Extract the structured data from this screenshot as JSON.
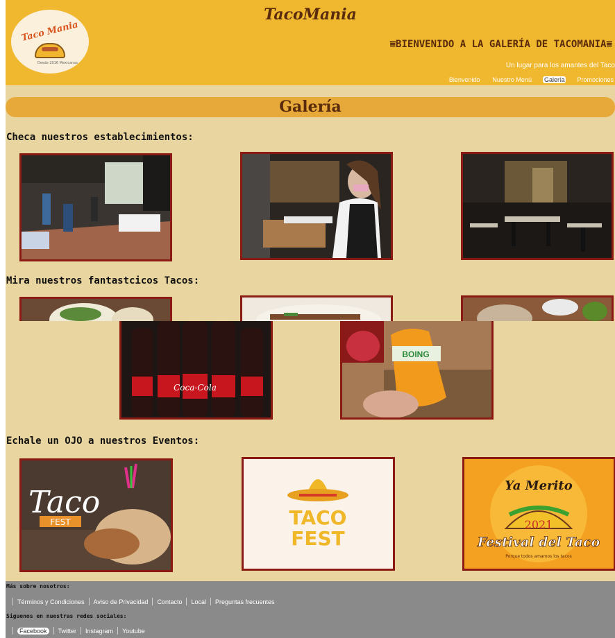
{
  "header": {
    "logo_text": "Taco Mania",
    "logo_subtext": "Desde 2016 Mexicanos",
    "site_title": "TacoMania",
    "welcome": "⩸BIENVENIDO A LA GALERÍA DE TACOMANIA⩸",
    "tagline": "Un lugar para los amantes del Taco"
  },
  "nav": {
    "items": [
      "Bienvenido",
      "Nuestro Menú",
      "Galería",
      "Promociones"
    ],
    "active": "Galería"
  },
  "gallery": {
    "title": "Galería",
    "establishments_title": "Checa nuestros establecimientos:",
    "tacos_title": "Mira nuestros fantastcicos Tacos:",
    "events_title": "Echale un OJO a nuestros Eventos:"
  },
  "events": {
    "taco_fest_1": {
      "big": "Taco",
      "small": "FEST"
    },
    "taco_fest_2": {
      "line1": "TACO",
      "line2": "FEST"
    },
    "festival": {
      "top": "Ya Merito",
      "year": "2021",
      "name": "Festival del Taco",
      "slogan": "Porque todos amamos los tacos"
    }
  },
  "drinks": {
    "cola_label": "Coca-Cola",
    "boing_label": "BOING"
  },
  "footer": {
    "about_label": "Más sobre nosotros:",
    "about_links": [
      "Términos y Condiciones",
      "Aviso de Privacidad",
      "Contacto",
      "Local",
      "Preguntas frecuentes"
    ],
    "social_label": "Siguenos en nuestras redes sociales:",
    "social_links": [
      "Facebook",
      "Twitter",
      "Instagram",
      "Youtube"
    ],
    "social_active": "Facebook"
  },
  "colors": {
    "header_bg": "#f0b82e",
    "page_bg": "#e9d59f",
    "banner_bg": "#e7a93a",
    "frame": "#8b1a14",
    "footer_bg": "#8a8a8a",
    "title_text": "#5a2a0c"
  }
}
